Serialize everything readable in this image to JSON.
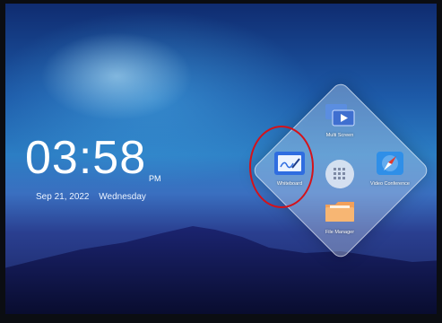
{
  "clock": {
    "time": "03:58",
    "ampm": "PM",
    "date": "Sep 21, 2022",
    "weekday": "Wednesday"
  },
  "launcher": {
    "apps": [
      {
        "label": "Multi Screen",
        "icon": "multi-screen-icon"
      },
      {
        "label": "Whiteboard",
        "icon": "whiteboard-icon"
      },
      {
        "label": "Video Conference",
        "icon": "video-conference-icon"
      },
      {
        "label": "File Manager",
        "icon": "folder-icon"
      }
    ],
    "center_icon": "grid-icon"
  },
  "annotation": {
    "color": "#d4121a"
  }
}
